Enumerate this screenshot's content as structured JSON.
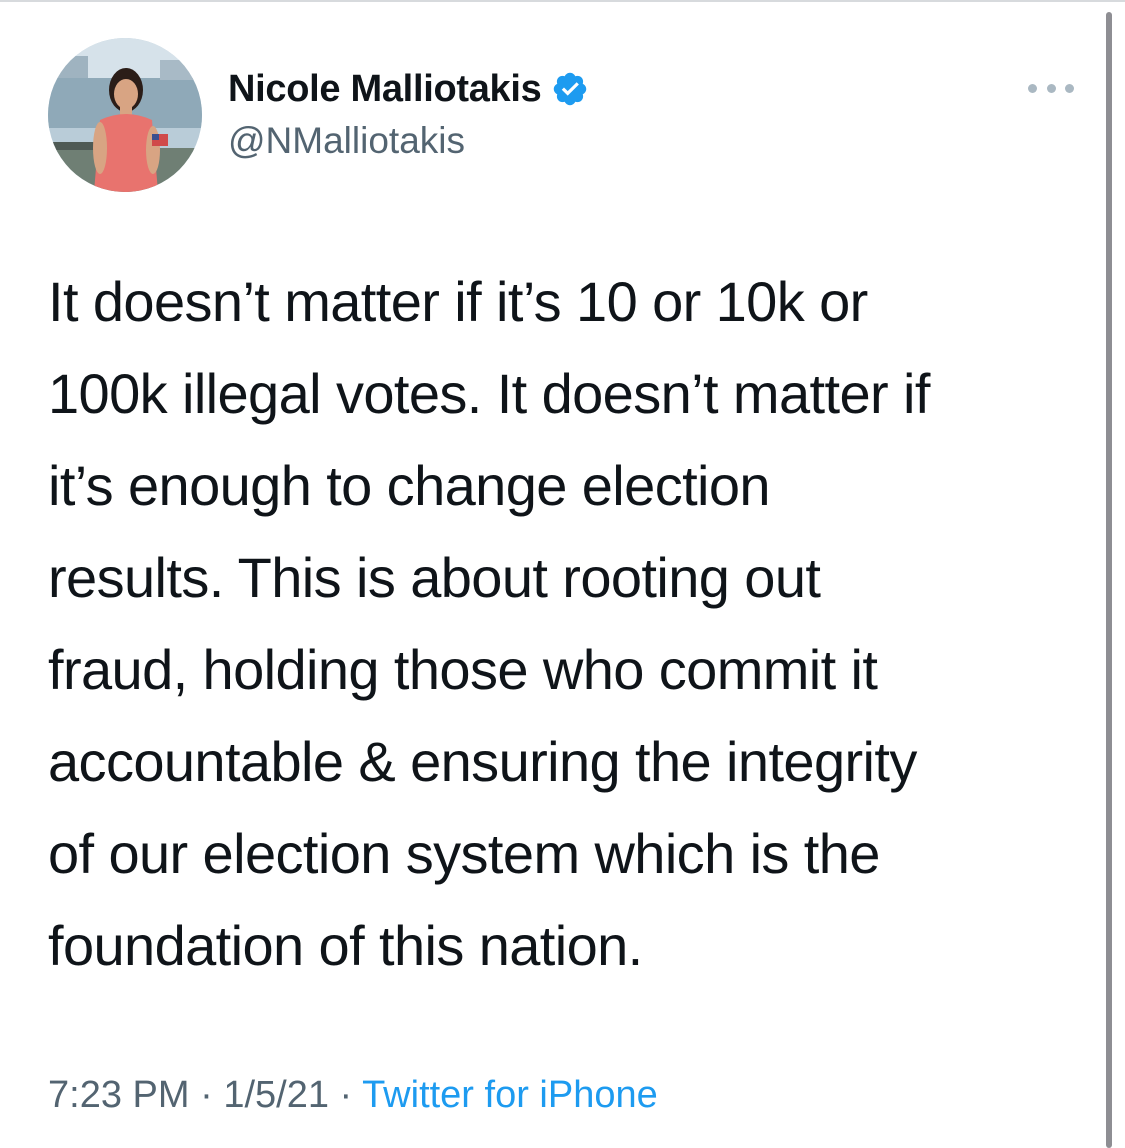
{
  "author": {
    "display_name": "Nicole Malliotakis",
    "handle": "@NMalliotakis",
    "avatar_icon": "profile-photo",
    "verified_icon": "verified-badge-icon",
    "verified_color": "#1d9bf0"
  },
  "more_menu_icon": "more-options-icon",
  "tweet": {
    "text": "It doesn’t matter if it’s 10 or 10k or\n100k illegal votes. It doesn’t matter if\nit’s enough to change election\nresults. This is about rooting out\nfraud, holding those who commit it\naccountable & ensuring the integrity\nof our election system which is the\nfoundation of this nation."
  },
  "meta": {
    "time": "7:23 PM",
    "separator": " · ",
    "date": "1/5/21",
    "source": "Twitter for iPhone"
  },
  "colors": {
    "text": "#0f1419",
    "secondary": "#536471",
    "link": "#1d9bf0"
  }
}
